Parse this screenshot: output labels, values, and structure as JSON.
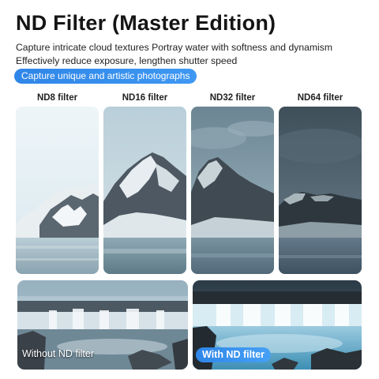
{
  "header": {
    "title": "ND Filter (Master Edition)",
    "line1": "Capture intricate cloud textures Portray water with softness and dynamism",
    "line2": "Effectively reduce exposure, lengthen shutter speed",
    "pill": "Capture unique and artistic photographs"
  },
  "filters": [
    {
      "label": "ND8 filter"
    },
    {
      "label": "ND16 filter"
    },
    {
      "label": "ND32 filter"
    },
    {
      "label": "ND64 filter"
    }
  ],
  "comparison": {
    "without_label": "Without ND filter",
    "with_label": "With ND filter"
  },
  "colors": {
    "accent": "#2f86e8"
  }
}
